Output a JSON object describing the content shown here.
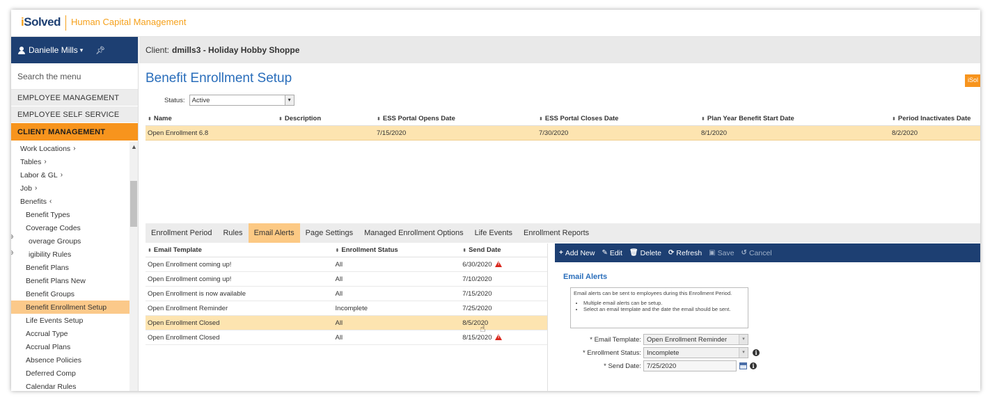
{
  "brand": {
    "logo_prefix": "i",
    "logo_main": "Solved",
    "app_title": "Human Capital Management"
  },
  "user": {
    "name": "Danielle Mills"
  },
  "sidebar": {
    "search_placeholder": "Search the menu",
    "sections": [
      "EMPLOYEE MANAGEMENT",
      "EMPLOYEE SELF SERVICE",
      "CLIENT MANAGEMENT"
    ],
    "items": [
      {
        "label": "Work Locations",
        "chev": "›"
      },
      {
        "label": "Tables",
        "chev": "›"
      },
      {
        "label": "Labor & GL",
        "chev": "›"
      },
      {
        "label": "Job",
        "chev": "›"
      },
      {
        "label": "Benefits",
        "chev": "‹"
      },
      {
        "label": "Benefit Types"
      },
      {
        "label": "Coverage Codes"
      },
      {
        "label": "overage Groups"
      },
      {
        "label": "igibility Rules"
      },
      {
        "label": "Benefit Plans"
      },
      {
        "label": "Benefit Plans New"
      },
      {
        "label": "Benefit Groups"
      },
      {
        "label": "Benefit Enrollment Setup"
      },
      {
        "label": "Life Events Setup"
      },
      {
        "label": "Accrual Type"
      },
      {
        "label": "Accrual Plans"
      },
      {
        "label": "Absence Policies"
      },
      {
        "label": "Deferred Comp"
      },
      {
        "label": "Calendar Rules"
      }
    ]
  },
  "client": {
    "prefix": "Client:",
    "name": "dmills3 - Holiday Hobby Shoppe"
  },
  "page": {
    "title": "Benefit Enrollment Setup",
    "brand_chip": "iSol"
  },
  "status": {
    "label": "Status:",
    "value": "Active"
  },
  "enrollment_grid": {
    "columns": [
      "Name",
      "Description",
      "ESS Portal Opens Date",
      "ESS Portal Closes Date",
      "Plan Year Benefit Start Date",
      "Period Inactivates Date"
    ],
    "rows": [
      [
        "Open Enrollment 6.8",
        "",
        "7/15/2020",
        "7/30/2020",
        "8/1/2020",
        "8/2/2020"
      ]
    ]
  },
  "tabs": [
    "Enrollment Period",
    "Rules",
    "Email Alerts",
    "Page Settings",
    "Managed Enrollment Options",
    "Life Events",
    "Enrollment Reports"
  ],
  "alerts_grid": {
    "columns": [
      "Email Template",
      "Enrollment Status",
      "Send Date"
    ],
    "rows": [
      {
        "template": "Open Enrollment coming up!",
        "status": "All",
        "date": "6/30/2020",
        "warn": true
      },
      {
        "template": "Open Enrollment coming up!",
        "status": "All",
        "date": "7/10/2020",
        "warn": false
      },
      {
        "template": "Open Enrollment is now available",
        "status": "All",
        "date": "7/15/2020",
        "warn": false
      },
      {
        "template": "Open Enrollment Reminder",
        "status": "Incomplete",
        "date": "7/25/2020",
        "warn": false
      },
      {
        "template": "Open Enrollment Closed",
        "status": "All",
        "date": "8/5/2020",
        "warn": false
      },
      {
        "template": "Open Enrollment Closed",
        "status": "All",
        "date": "8/15/2020",
        "warn": true
      }
    ]
  },
  "toolbar": {
    "add": "Add New",
    "edit": "Edit",
    "delete": "Delete",
    "refresh": "Refresh",
    "save": "Save",
    "cancel": "Cancel"
  },
  "detail": {
    "title": "Email Alerts",
    "info_text": "Email alerts can be sent to employees during this Enrollment Period.",
    "info_bullets": [
      "Multiple email alerts can be setup.",
      "Select an email template and the date the email should be sent."
    ],
    "template_label": "* Email Template:",
    "template_value": "Open Enrollment Reminder",
    "status_label": "* Enrollment Status:",
    "status_value": "Incomplete",
    "date_label": "* Send Date:",
    "date_value": "7/25/2020"
  },
  "colors": {
    "navy": "#1d3f72",
    "orange": "#f7941d",
    "highlight": "#fde4b0",
    "title_blue": "#2a6ebb"
  }
}
